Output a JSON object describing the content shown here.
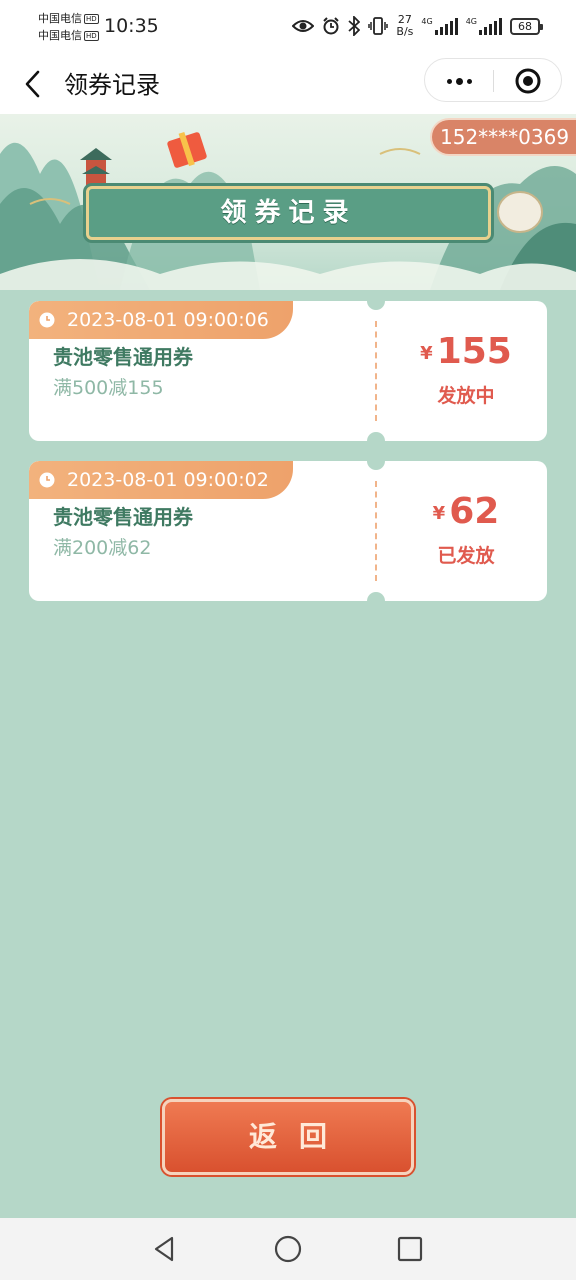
{
  "status_bar": {
    "carrier1": "中国电信",
    "carrier2": "中国电信",
    "hd_badge": "HD",
    "time": "10:35",
    "net_speed_value": "27",
    "net_speed_unit": "B/s",
    "signal1_label": "4G",
    "signal2_label": "4G",
    "battery": "68",
    "icons": [
      "eye-icon",
      "alarm-icon",
      "bluetooth-icon",
      "vibrate-icon",
      "signal-icon",
      "signal-icon",
      "battery-icon"
    ]
  },
  "nav": {
    "title": "领券记录",
    "back_icon": "chevron-left-icon",
    "more_icon": "more-dots-icon",
    "close_icon": "target-icon"
  },
  "banner": {
    "phone": "152****0369",
    "title": "领券记录"
  },
  "coupons": [
    {
      "time": "2023-08-01 09:00:06",
      "name": "贵池零售通用券",
      "rule": "满500减155",
      "currency": "¥",
      "amount": "155",
      "status": "发放中"
    },
    {
      "time": "2023-08-01 09:00:02",
      "name": "贵池零售通用券",
      "rule": "满200减62",
      "currency": "¥",
      "amount": "62",
      "status": "已发放"
    }
  ],
  "return_button": "返回",
  "colors": {
    "background": "#b5d7c8",
    "accent_red": "#e05a4e",
    "tag_orange": "#f2b27d",
    "title_green": "#3f7a62",
    "plaque_green": "#5a9e85",
    "button_red": "#d9512f"
  },
  "system_nav": {
    "icons": [
      "back-triangle-icon",
      "home-circle-icon",
      "recents-square-icon"
    ]
  }
}
